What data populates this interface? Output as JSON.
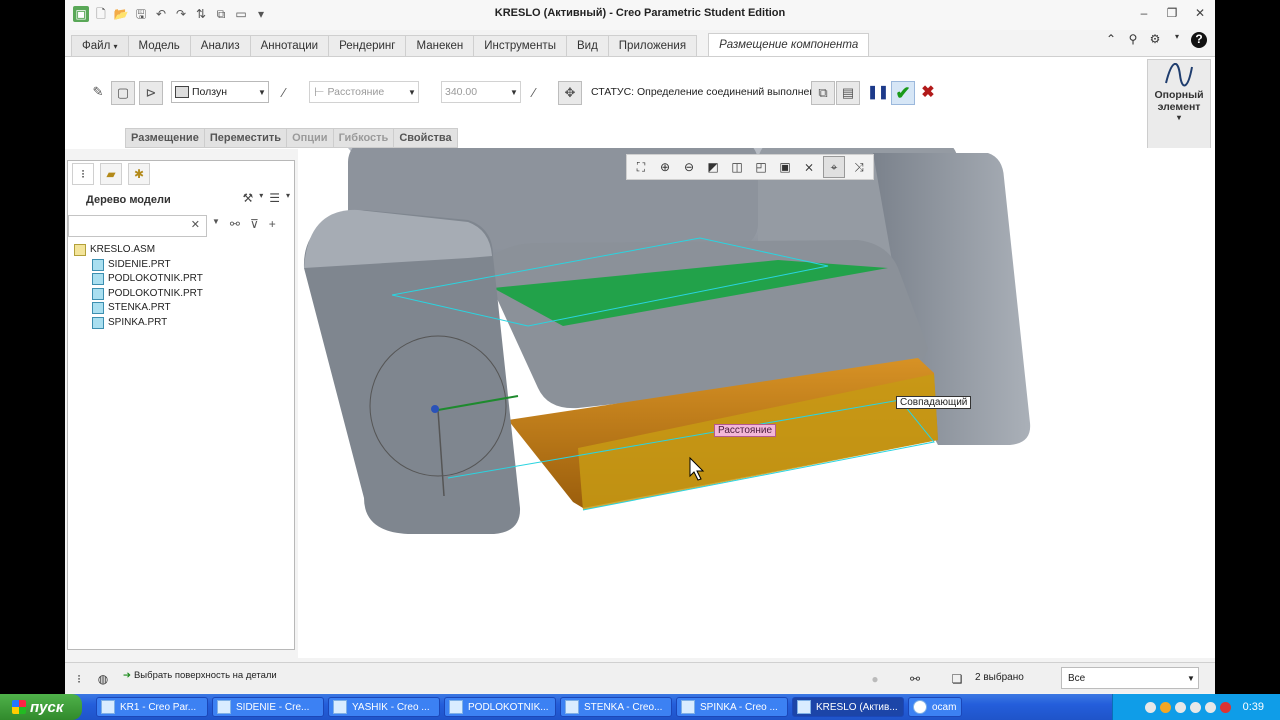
{
  "window": {
    "title": "KRESLO (Активный) - Creo Parametric Student Edition"
  },
  "ribbon_tabs": {
    "file": "Файл",
    "file_arrow": "▾",
    "items": [
      "Модель",
      "Анализ",
      "Аннотации",
      "Рендеринг",
      "Манекен",
      "Инструменты",
      "Вид",
      "Приложения"
    ],
    "active": "Размещение компонента"
  },
  "ribbon": {
    "constraint_type": "Ползун",
    "distance_type": "Расстояние",
    "offset_value": "340.00",
    "status": "СТАТУС: Определение соединений выполнено.",
    "sub_tabs": [
      "Размещение",
      "Переместить",
      "Опции",
      "Гибкость",
      "Свойства"
    ],
    "datum_label_1": "Опорный",
    "datum_label_2": "элемент",
    "datum_arrow": "▾"
  },
  "model_tree": {
    "header": "Дерево модели",
    "root": "KRESLO.ASM",
    "children": [
      "SIDENIE.PRT",
      "PODLOKOTNIK.PRT",
      "PODLOKOTNIK.PRT",
      "STENKA.PRT",
      "SPINKA.PRT"
    ]
  },
  "graphics": {
    "label_distance": "Расстояние",
    "label_coincident": "Совпадающий"
  },
  "status_bar": {
    "message": "Выбрать поверхность на детали",
    "selected": "2 выбрано",
    "filter": "Все"
  },
  "taskbar": {
    "start": "пуск",
    "tasks": [
      "KR1 - Creo Par...",
      "SIDENIE - Cre...",
      "YASHIK - Creo ...",
      "PODLOKOTNIK...",
      "STENKA - Creo...",
      "SPINKA - Creo ...",
      "KRESLO (Актив...",
      "ocam"
    ],
    "clock": "0:39"
  }
}
